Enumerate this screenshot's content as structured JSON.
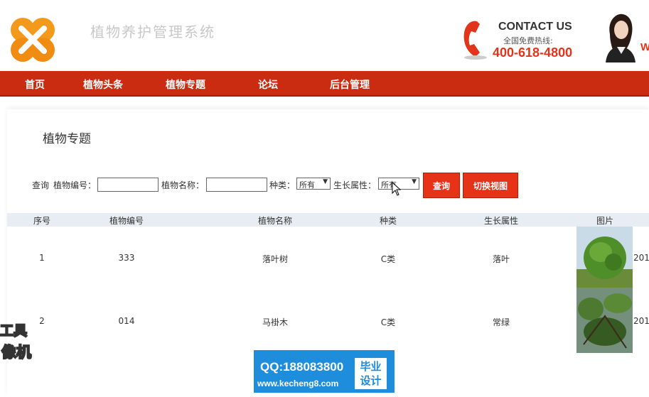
{
  "header": {
    "site_title": "植物养护管理系统",
    "contact_title": "CONTACT US",
    "contact_sub": "全国免费热线:",
    "contact_number": "400-618-4800",
    "edge_letter": "W"
  },
  "nav": {
    "items": [
      {
        "label": "首页"
      },
      {
        "label": "植物头条"
      },
      {
        "label": "植物专题"
      },
      {
        "label": "论坛"
      },
      {
        "label": "后台管理"
      }
    ]
  },
  "page": {
    "title": "植物专题"
  },
  "search": {
    "prefix": "查询",
    "code_label": "植物编号：",
    "code_value": "",
    "name_label": "植物名称：",
    "name_value": "",
    "type_label": "种类：",
    "type_selected": "所有",
    "growth_label": "生长属性：",
    "growth_selected": "所有",
    "query_button": "查询",
    "switch_view_button": "切换视图"
  },
  "table": {
    "columns": [
      "序号",
      "植物编号",
      "植物名称",
      "种类",
      "生长属性",
      "图片"
    ],
    "rows": [
      {
        "index": "1",
        "code": "333",
        "name": "落叶树",
        "type": "C类",
        "growth": "落叶",
        "clipped": "201"
      },
      {
        "index": "2",
        "code": "014",
        "name": "马褂木",
        "type": "C类",
        "growth": "常绿",
        "clipped": "201"
      }
    ]
  },
  "watermark": {
    "qq": "QQ:188083800",
    "url": "www.kecheng8.com",
    "tag_line1": "毕业",
    "tag_line2": "设计",
    "left_line1": "工具",
    "left_line2": "像机"
  },
  "colors": {
    "nav": "#c92c10",
    "button": "#e63217",
    "accent": "#e0351a",
    "table_header": "#e7edf2",
    "watermark": "#1e8ddc"
  }
}
